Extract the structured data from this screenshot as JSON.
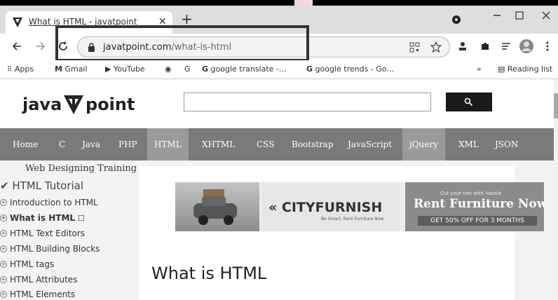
{
  "browser": {
    "tab_title": "What is HTML - javatpoint",
    "url_host": "javatpoint.com",
    "url_path": "/what-is-html"
  },
  "bookmarks": [
    {
      "label": "Apps"
    },
    {
      "label": "Gmail"
    },
    {
      "label": "YouTube"
    },
    {
      "label": ""
    },
    {
      "label": "G"
    },
    {
      "label": "google translate -..."
    },
    {
      "label": "google trends - Go..."
    }
  ],
  "bookmarks_more": "»",
  "reading_list": "Reading list",
  "site": {
    "logo_left": "java",
    "logo_right": "point",
    "search_placeholder": ""
  },
  "nav": [
    {
      "label": "Home"
    },
    {
      "label": "C"
    },
    {
      "label": "Java"
    },
    {
      "label": "PHP"
    },
    {
      "label": "HTML"
    },
    {
      "label": "XHTML"
    },
    {
      "label": "CSS"
    },
    {
      "label": "Bootstrap"
    },
    {
      "label": "JavaScript"
    },
    {
      "label": "jQuery"
    },
    {
      "label": "XML"
    },
    {
      "label": "JSON"
    }
  ],
  "sidebar": {
    "heading": "Web Designing Training",
    "title": "HTML Tutorial",
    "items": [
      {
        "label": "Introduction to HTML"
      },
      {
        "label": "What is HTML"
      },
      {
        "label": "HTML Text Editors"
      },
      {
        "label": "HTML Building Blocks"
      },
      {
        "label": "HTML tags"
      },
      {
        "label": "HTML Attributes"
      },
      {
        "label": "HTML Elements"
      }
    ]
  },
  "ad": {
    "brand": "CITYFURNISH",
    "tagline": "Be Smart, Rent Furniture Now",
    "small": "Cut your ties with Hassle",
    "headline": "Rent Furniture Now",
    "offer": "GET 50% OFF FOR 3 MONTHS"
  },
  "content": {
    "heading": "What is HTML"
  },
  "colors": {
    "nav_bg": "#7a7a7a",
    "nav_active": "#9a9a9a",
    "search_button": "#1a1a1a"
  }
}
